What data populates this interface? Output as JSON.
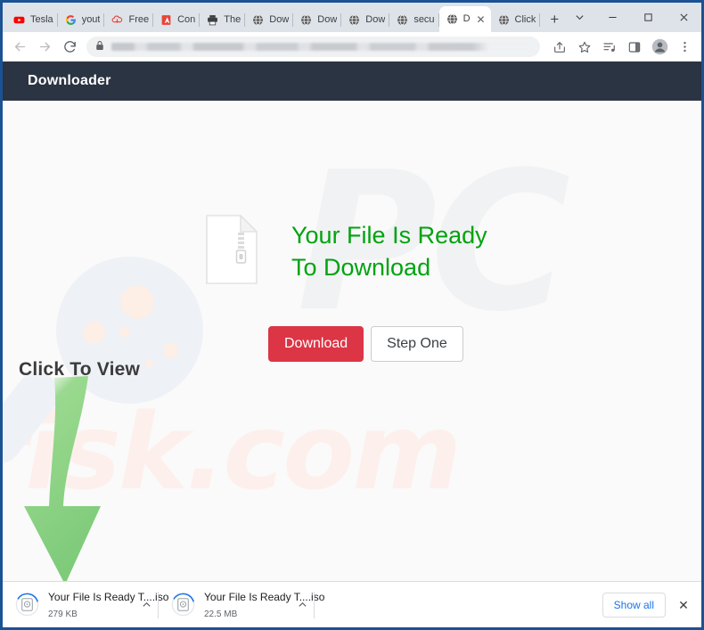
{
  "browser": {
    "tabs": [
      {
        "label": "Tesla",
        "icon": "youtube-favicon",
        "active": false
      },
      {
        "label": "yout",
        "icon": "google-favicon",
        "active": false
      },
      {
        "label": "Free",
        "icon": "cloud-download-favicon",
        "active": false
      },
      {
        "label": "Con",
        "icon": "red-doc-favicon",
        "active": false
      },
      {
        "label": "The",
        "icon": "printer-favicon",
        "active": false
      },
      {
        "label": "Dow",
        "icon": "globe-favicon",
        "active": false
      },
      {
        "label": "Dow",
        "icon": "globe-favicon",
        "active": false
      },
      {
        "label": "Dow",
        "icon": "globe-favicon",
        "active": false
      },
      {
        "label": "secu",
        "icon": "globe-favicon",
        "active": false
      },
      {
        "label": "D",
        "icon": "globe-favicon",
        "active": true
      },
      {
        "label": "Click",
        "icon": "globe-favicon",
        "active": false
      }
    ],
    "new_tab_label": "+",
    "window_controls": {
      "tab_search": "tab-search-chevron",
      "minimize": "minimize",
      "maximize": "maximize",
      "close": "close"
    },
    "toolbar": {
      "back": "back-arrow",
      "forward": "forward-arrow",
      "reload": "reload",
      "site_lock": "lock-icon",
      "url_value": "",
      "url_placeholder": "",
      "share": "share-icon",
      "bookmark": "star-icon",
      "media": "media-list-icon",
      "side_panel": "side-panel-icon",
      "profile": "profile-avatar",
      "menu": "three-dot-menu"
    }
  },
  "page": {
    "header_title": "Downloader",
    "heading": "Your File Is Ready To Download",
    "heading_color": "#00a310",
    "file_icon": "zip-file-icon",
    "buttons": {
      "download": "Download",
      "download_color": "#dc3545",
      "step_one": "Step One"
    },
    "cta_text": "Click To View",
    "arrow_icon": "green-curved-down-arrow",
    "watermark_brand": "PC",
    "watermark_domain": "risk.com"
  },
  "downloads_shelf": {
    "items": [
      {
        "name": "Your File Is Ready T....iso",
        "size": "279 KB",
        "icon": "iso-disc-icon",
        "caret": "chevron-up"
      },
      {
        "name": "Your File Is Ready T....iso",
        "size": "22.5 MB",
        "icon": "iso-disc-icon",
        "caret": "chevron-up"
      }
    ],
    "show_all_label": "Show all",
    "close_label": "close-shelf"
  }
}
